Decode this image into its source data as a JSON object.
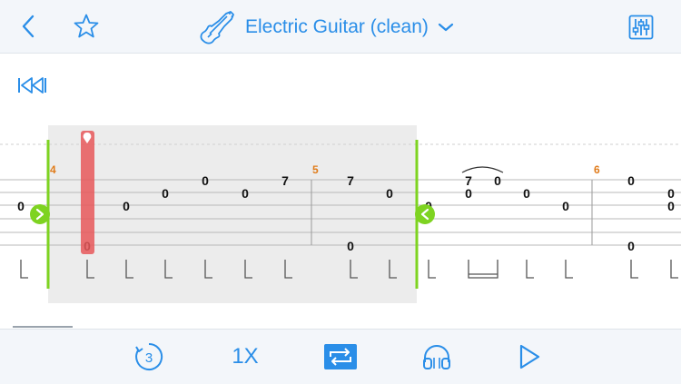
{
  "header": {
    "title": "Electric Guitar (clean)",
    "icons": [
      "back-chevron-icon",
      "star-icon",
      "guitar-icon",
      "chevron-down-icon",
      "mixer-icon"
    ]
  },
  "controls": {
    "countin": "3",
    "speed": "1X",
    "icons": [
      "rewind-to-start-icon",
      "countin-icon",
      "loop-icon",
      "headphones-icon",
      "play-icon"
    ]
  },
  "colors": {
    "accent": "#2a8ee8",
    "loop_marker": "#7ed321",
    "cursor": "#e8585a",
    "bar_number": "#e07b1a"
  },
  "score": {
    "bars": [
      {
        "number": "4"
      },
      {
        "number": "5"
      },
      {
        "number": "6"
      }
    ],
    "notes": [
      {
        "fret": "0"
      },
      {
        "fret": "0"
      },
      {
        "fret": "0"
      },
      {
        "fret": "0"
      },
      {
        "fret": "0"
      },
      {
        "fret": "0"
      },
      {
        "fret": "7"
      },
      {
        "fret": "7"
      },
      {
        "fret": "0"
      },
      {
        "fret": "0"
      },
      {
        "fret": "0"
      },
      {
        "fret": "7"
      },
      {
        "fret": "0"
      },
      {
        "fret": "0"
      },
      {
        "fret": "0"
      },
      {
        "fret": "0"
      },
      {
        "fret": "0"
      },
      {
        "fret": "0"
      },
      {
        "fret": "0"
      },
      {
        "fret": "0"
      }
    ]
  }
}
